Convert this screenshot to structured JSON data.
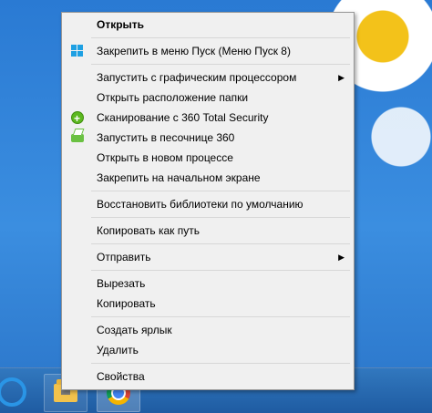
{
  "context_menu": {
    "items": [
      {
        "type": "item",
        "label": "Открыть",
        "bold": true
      },
      {
        "type": "separator"
      },
      {
        "type": "item",
        "label": "Закрепить в меню Пуск (Меню Пуск 8)",
        "icon": "windows-start-icon"
      },
      {
        "type": "separator"
      },
      {
        "type": "item",
        "label": "Запустить с графическим процессором",
        "submenu": true
      },
      {
        "type": "item",
        "label": "Открыть расположение папки"
      },
      {
        "type": "item",
        "label": "Сканирование с 360 Total Security",
        "icon": "360-security-icon"
      },
      {
        "type": "item",
        "label": "Запустить в песочнице 360",
        "icon": "360-sandbox-icon"
      },
      {
        "type": "item",
        "label": "Открыть в новом процессе"
      },
      {
        "type": "item",
        "label": "Закрепить на начальном экране"
      },
      {
        "type": "separator"
      },
      {
        "type": "item",
        "label": "Восстановить библиотеки по умолчанию"
      },
      {
        "type": "separator"
      },
      {
        "type": "item",
        "label": "Копировать как путь"
      },
      {
        "type": "separator"
      },
      {
        "type": "item",
        "label": "Отправить",
        "submenu": true
      },
      {
        "type": "separator"
      },
      {
        "type": "item",
        "label": "Вырезать"
      },
      {
        "type": "item",
        "label": "Копировать"
      },
      {
        "type": "separator"
      },
      {
        "type": "item",
        "label": "Создать ярлык"
      },
      {
        "type": "item",
        "label": "Удалить"
      },
      {
        "type": "separator"
      },
      {
        "type": "item",
        "label": "Свойства"
      }
    ],
    "submenu_arrow": "▶"
  },
  "taskbar": {
    "items": [
      "internet-explorer-icon",
      "file-explorer-icon",
      "chrome-icon"
    ]
  }
}
